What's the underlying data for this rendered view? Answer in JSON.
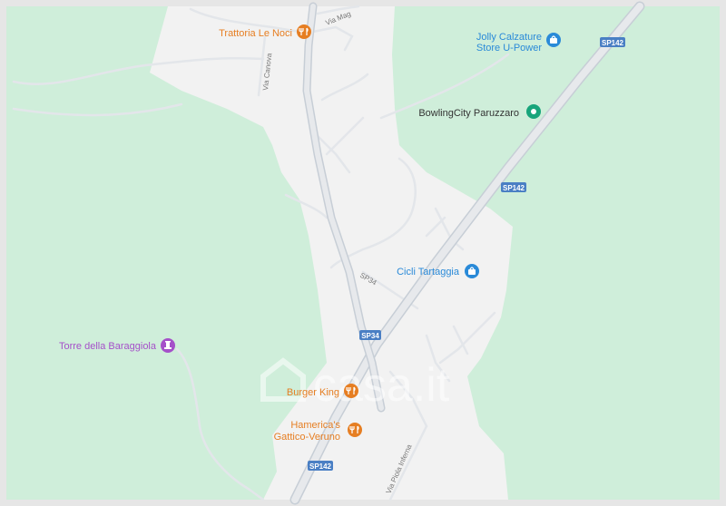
{
  "map": {
    "colors": {
      "green": "#cfeeda",
      "land": "#f2f2f2",
      "road": "#ffffff",
      "major_road": "#c7ced6",
      "shield": "#4a7fc4",
      "food": "#e67e22",
      "shop": "#2a8ad8",
      "leisure": "#18a57b",
      "landmark": "#a550c9"
    },
    "pois": {
      "trattoria": {
        "label": "Trattoria Le Noci",
        "icon": "restaurant-icon"
      },
      "jolly": {
        "line1": "Jolly Calzature",
        "line2": "Store U-Power",
        "icon": "shopping-bag-icon"
      },
      "bowling": {
        "label": "BowlingCity Paruzzaro",
        "icon": "place-pin-icon"
      },
      "cicli": {
        "label": "Cicli Tartaggia",
        "icon": "shopping-bag-icon"
      },
      "torre": {
        "label": "Torre della Baraggiola",
        "icon": "landmark-icon"
      },
      "burger": {
        "label": "Burger King",
        "icon": "restaurant-icon"
      },
      "hamerica": {
        "line1": "Hamerica's",
        "line2": "Gattico-Veruno",
        "icon": "restaurant-icon"
      }
    },
    "shields": {
      "sp142_top": "SP142",
      "sp142_mid": "SP142",
      "sp34": "SP34",
      "sp142_bottom": "SP142"
    },
    "streets": {
      "via_canova": "Via Canova",
      "via_mag": "Via Mag",
      "sp34": "SP34",
      "via_piola": "Via Piola Inferna"
    },
    "watermark": "casa.it"
  }
}
